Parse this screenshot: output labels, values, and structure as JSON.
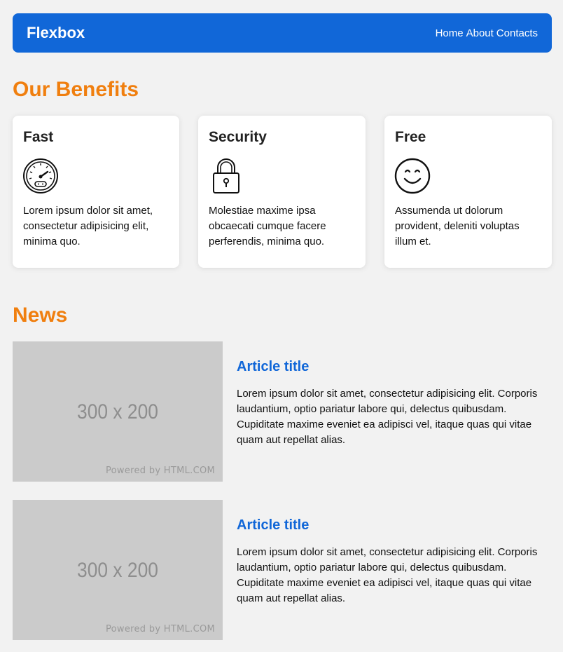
{
  "header": {
    "logo": "Flexbox",
    "nav": [
      "Home",
      "About",
      "Contacts"
    ]
  },
  "benefits": {
    "title": "Our Benefits",
    "cards": [
      {
        "title": "Fast",
        "icon": "speedometer-icon",
        "text": "Lorem ipsum dolor sit amet, consectetur adipisicing elit, minima quo."
      },
      {
        "title": "Security",
        "icon": "padlock-icon",
        "text": "Molestiae maxime ipsa obcaecati cumque facere perferendis, minima quo."
      },
      {
        "title": "Free",
        "icon": "smiley-icon",
        "text": "Assumenda ut dolorum provident, deleniti voluptas illum et."
      }
    ]
  },
  "news": {
    "title": "News",
    "articles": [
      {
        "image_text": "300 x 200",
        "image_credit": "Powered by HTML.COM",
        "title": "Article title",
        "text": "Lorem ipsum dolor sit amet, consectetur adipisicing elit. Corporis laudantium, optio pariatur labore qui, delectus quibusdam. Cupiditate maxime eveniet ea adipisci vel, itaque quas qui vitae quam aut repellat alias."
      },
      {
        "image_text": "300 x 200",
        "image_credit": "Powered by HTML.COM",
        "title": "Article title",
        "text": "Lorem ipsum dolor sit amet, consectetur adipisicing elit. Corporis laudantium, optio pariatur labore qui, delectus quibusdam. Cupiditate maxime eveniet ea adipisci vel, itaque quas qui vitae quam aut repellat alias."
      }
    ]
  },
  "colors": {
    "primary": "#1167d8",
    "accent": "#f07f0f",
    "background": "#f2f2f2",
    "placeholder": "#cbcbcb"
  }
}
